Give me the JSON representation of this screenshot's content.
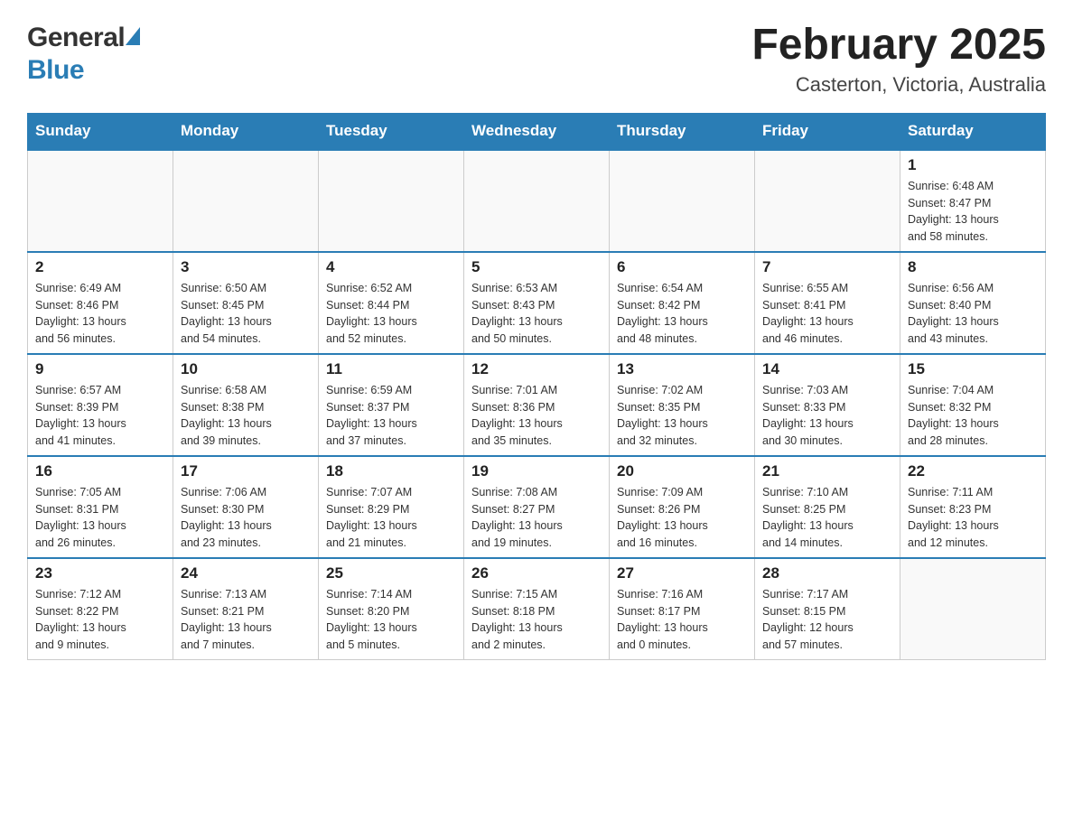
{
  "header": {
    "logo_general": "General",
    "logo_blue": "Blue",
    "month_title": "February 2025",
    "location": "Casterton, Victoria, Australia"
  },
  "weekdays": [
    "Sunday",
    "Monday",
    "Tuesday",
    "Wednesday",
    "Thursday",
    "Friday",
    "Saturday"
  ],
  "weeks": [
    [
      {
        "day": "",
        "info": ""
      },
      {
        "day": "",
        "info": ""
      },
      {
        "day": "",
        "info": ""
      },
      {
        "day": "",
        "info": ""
      },
      {
        "day": "",
        "info": ""
      },
      {
        "day": "",
        "info": ""
      },
      {
        "day": "1",
        "info": "Sunrise: 6:48 AM\nSunset: 8:47 PM\nDaylight: 13 hours\nand 58 minutes."
      }
    ],
    [
      {
        "day": "2",
        "info": "Sunrise: 6:49 AM\nSunset: 8:46 PM\nDaylight: 13 hours\nand 56 minutes."
      },
      {
        "day": "3",
        "info": "Sunrise: 6:50 AM\nSunset: 8:45 PM\nDaylight: 13 hours\nand 54 minutes."
      },
      {
        "day": "4",
        "info": "Sunrise: 6:52 AM\nSunset: 8:44 PM\nDaylight: 13 hours\nand 52 minutes."
      },
      {
        "day": "5",
        "info": "Sunrise: 6:53 AM\nSunset: 8:43 PM\nDaylight: 13 hours\nand 50 minutes."
      },
      {
        "day": "6",
        "info": "Sunrise: 6:54 AM\nSunset: 8:42 PM\nDaylight: 13 hours\nand 48 minutes."
      },
      {
        "day": "7",
        "info": "Sunrise: 6:55 AM\nSunset: 8:41 PM\nDaylight: 13 hours\nand 46 minutes."
      },
      {
        "day": "8",
        "info": "Sunrise: 6:56 AM\nSunset: 8:40 PM\nDaylight: 13 hours\nand 43 minutes."
      }
    ],
    [
      {
        "day": "9",
        "info": "Sunrise: 6:57 AM\nSunset: 8:39 PM\nDaylight: 13 hours\nand 41 minutes."
      },
      {
        "day": "10",
        "info": "Sunrise: 6:58 AM\nSunset: 8:38 PM\nDaylight: 13 hours\nand 39 minutes."
      },
      {
        "day": "11",
        "info": "Sunrise: 6:59 AM\nSunset: 8:37 PM\nDaylight: 13 hours\nand 37 minutes."
      },
      {
        "day": "12",
        "info": "Sunrise: 7:01 AM\nSunset: 8:36 PM\nDaylight: 13 hours\nand 35 minutes."
      },
      {
        "day": "13",
        "info": "Sunrise: 7:02 AM\nSunset: 8:35 PM\nDaylight: 13 hours\nand 32 minutes."
      },
      {
        "day": "14",
        "info": "Sunrise: 7:03 AM\nSunset: 8:33 PM\nDaylight: 13 hours\nand 30 minutes."
      },
      {
        "day": "15",
        "info": "Sunrise: 7:04 AM\nSunset: 8:32 PM\nDaylight: 13 hours\nand 28 minutes."
      }
    ],
    [
      {
        "day": "16",
        "info": "Sunrise: 7:05 AM\nSunset: 8:31 PM\nDaylight: 13 hours\nand 26 minutes."
      },
      {
        "day": "17",
        "info": "Sunrise: 7:06 AM\nSunset: 8:30 PM\nDaylight: 13 hours\nand 23 minutes."
      },
      {
        "day": "18",
        "info": "Sunrise: 7:07 AM\nSunset: 8:29 PM\nDaylight: 13 hours\nand 21 minutes."
      },
      {
        "day": "19",
        "info": "Sunrise: 7:08 AM\nSunset: 8:27 PM\nDaylight: 13 hours\nand 19 minutes."
      },
      {
        "day": "20",
        "info": "Sunrise: 7:09 AM\nSunset: 8:26 PM\nDaylight: 13 hours\nand 16 minutes."
      },
      {
        "day": "21",
        "info": "Sunrise: 7:10 AM\nSunset: 8:25 PM\nDaylight: 13 hours\nand 14 minutes."
      },
      {
        "day": "22",
        "info": "Sunrise: 7:11 AM\nSunset: 8:23 PM\nDaylight: 13 hours\nand 12 minutes."
      }
    ],
    [
      {
        "day": "23",
        "info": "Sunrise: 7:12 AM\nSunset: 8:22 PM\nDaylight: 13 hours\nand 9 minutes."
      },
      {
        "day": "24",
        "info": "Sunrise: 7:13 AM\nSunset: 8:21 PM\nDaylight: 13 hours\nand 7 minutes."
      },
      {
        "day": "25",
        "info": "Sunrise: 7:14 AM\nSunset: 8:20 PM\nDaylight: 13 hours\nand 5 minutes."
      },
      {
        "day": "26",
        "info": "Sunrise: 7:15 AM\nSunset: 8:18 PM\nDaylight: 13 hours\nand 2 minutes."
      },
      {
        "day": "27",
        "info": "Sunrise: 7:16 AM\nSunset: 8:17 PM\nDaylight: 13 hours\nand 0 minutes."
      },
      {
        "day": "28",
        "info": "Sunrise: 7:17 AM\nSunset: 8:15 PM\nDaylight: 12 hours\nand 57 minutes."
      },
      {
        "day": "",
        "info": ""
      }
    ]
  ]
}
